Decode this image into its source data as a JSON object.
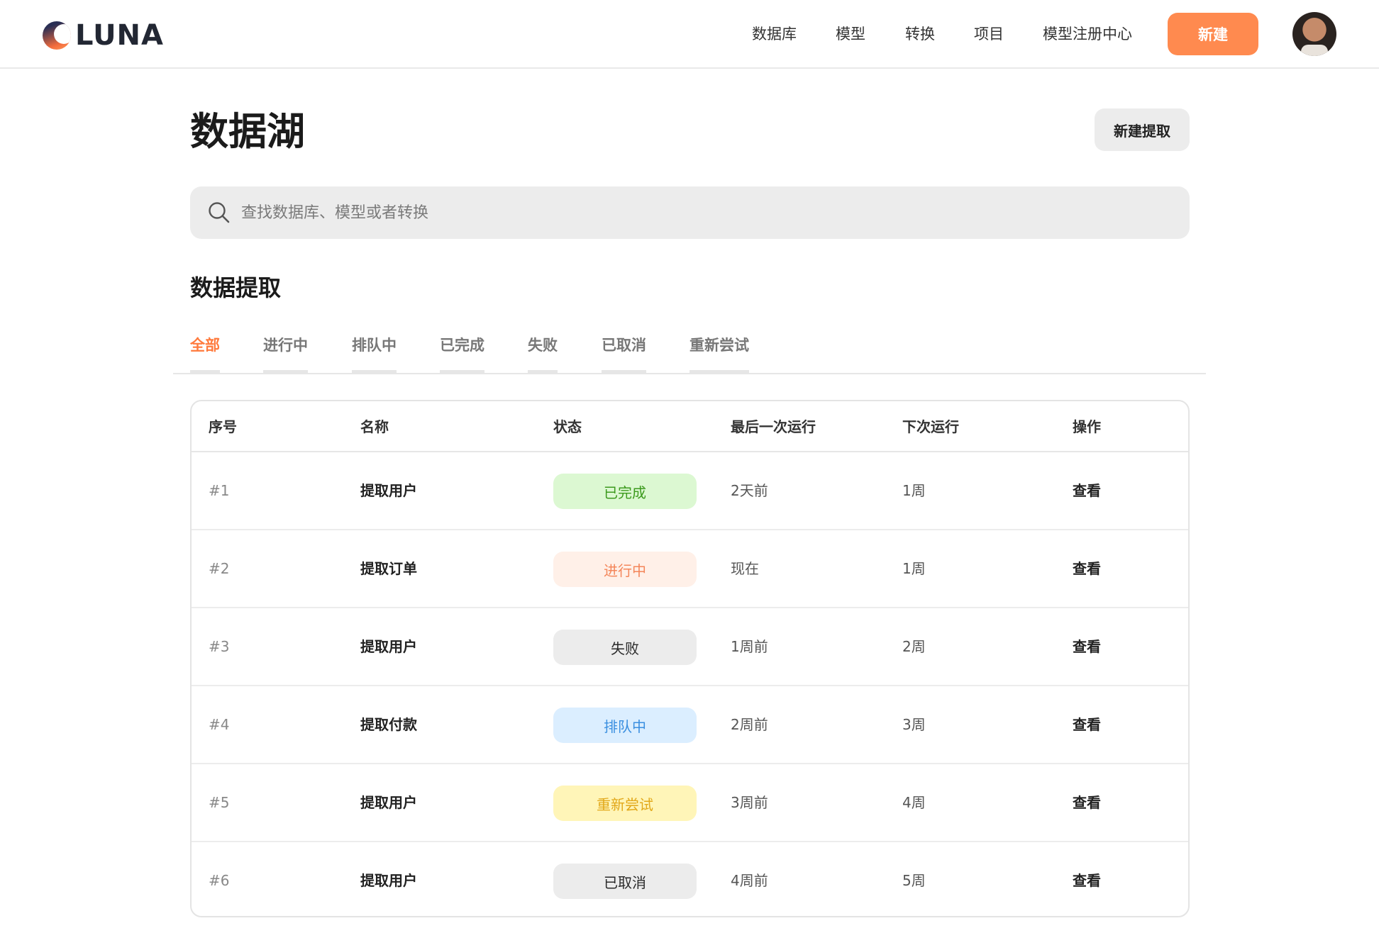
{
  "brand": {
    "name": "LUNA"
  },
  "nav": {
    "items": [
      "数据库",
      "模型",
      "转换",
      "项目",
      "模型注册中心"
    ],
    "new_label": "新建"
  },
  "header": {
    "title": "数据湖",
    "new_extract_label": "新建提取"
  },
  "search": {
    "placeholder": "查找数据库、模型或者转换",
    "value": ""
  },
  "section": {
    "title": "数据提取"
  },
  "tabs": {
    "items": [
      "全部",
      "进行中",
      "排队中",
      "已完成",
      "失败",
      "已取消",
      "重新尝试"
    ],
    "active_index": 0
  },
  "table": {
    "columns": [
      "序号",
      "名称",
      "状态",
      "最后一次运行",
      "下次运行",
      "操作"
    ],
    "rows": [
      {
        "id": "#1",
        "name": "提取用户",
        "status": "已完成",
        "last_run": "2天前",
        "next_run": "1周",
        "action": "查看"
      },
      {
        "id": "#2",
        "name": "提取订单",
        "status": "进行中",
        "last_run": "现在",
        "next_run": "1周",
        "action": "查看"
      },
      {
        "id": "#3",
        "name": "提取用户",
        "status": "失败",
        "last_run": "1周前",
        "next_run": "2周",
        "action": "查看"
      },
      {
        "id": "#4",
        "name": "提取付款",
        "status": "排队中",
        "last_run": "2周前",
        "next_run": "3周",
        "action": "查看"
      },
      {
        "id": "#5",
        "name": "提取用户",
        "status": "重新尝试",
        "last_run": "3周前",
        "next_run": "4周",
        "action": "查看"
      },
      {
        "id": "#6",
        "name": "提取用户",
        "status": "已取消",
        "last_run": "4周前",
        "next_run": "5周",
        "action": "查看"
      }
    ]
  },
  "status_colors": {
    "已完成": {
      "bg": "#dcf8d2",
      "fg": "#3c9a1d"
    },
    "进行中": {
      "bg": "#fff0e8",
      "fg": "#f4865a"
    },
    "失败": {
      "bg": "#ececec",
      "fg": "#2a2a2a"
    },
    "排队中": {
      "bg": "#dbeeff",
      "fg": "#3a8fe0"
    },
    "重新尝试": {
      "bg": "#fff5b8",
      "fg": "#e2a81a"
    },
    "已取消": {
      "bg": "#ececec",
      "fg": "#2a2a2a"
    }
  },
  "colors": {
    "accent": "#ff8a4f",
    "active_tab": "#ff7a3d"
  },
  "icons": {
    "search": "search-icon",
    "logo": "logo-mark-icon",
    "avatar": "avatar"
  }
}
